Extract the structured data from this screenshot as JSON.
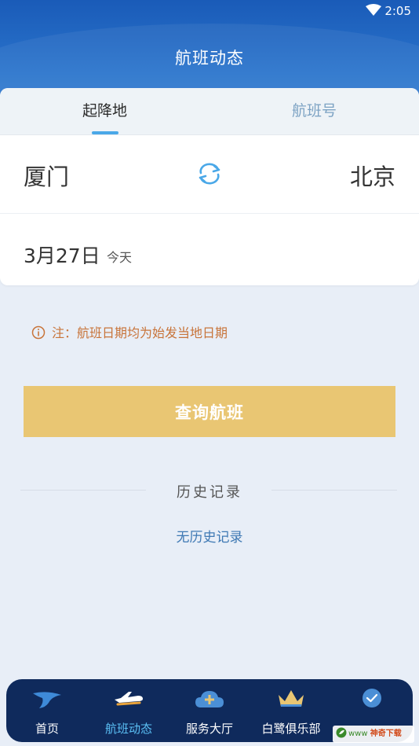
{
  "status_bar": {
    "time": "2:05",
    "wifi_icon": "wifi-icon"
  },
  "header": {
    "title": "航班动态"
  },
  "tabs": [
    {
      "label": "起降地",
      "active": true
    },
    {
      "label": "航班号",
      "active": false
    }
  ],
  "route": {
    "from": "厦门",
    "to": "北京",
    "swap_icon": "swap-arrows-icon"
  },
  "date": {
    "value": "3月27日",
    "relative": "今天"
  },
  "notice": {
    "icon": "info-icon",
    "text": "注：航班日期均为始发当地日期"
  },
  "search_button": {
    "label": "查询航班"
  },
  "history": {
    "title": "历史记录",
    "empty_text": "无历史记录"
  },
  "bottom_nav": [
    {
      "label": "首页",
      "icon": "egret-logo-icon",
      "active": false
    },
    {
      "label": "航班动态",
      "icon": "airplane-icon",
      "active": true
    },
    {
      "label": "服务大厅",
      "icon": "cloud-plus-icon",
      "active": false
    },
    {
      "label": "白鹭俱乐部",
      "icon": "crown-icon",
      "active": false
    },
    {
      "label": "",
      "icon": "profile-icon",
      "active": false
    }
  ],
  "watermark": {
    "prefix": "www",
    "text": "神奇下载"
  },
  "colors": {
    "header_blue": "#1a5bb8",
    "tab_indicator": "#4aa8e8",
    "notice_orange": "#c8743a",
    "search_button": "#e9c673",
    "link_blue": "#3f79b4",
    "nav_bg": "#0f2a5c",
    "nav_active": "#5bc0f5"
  }
}
